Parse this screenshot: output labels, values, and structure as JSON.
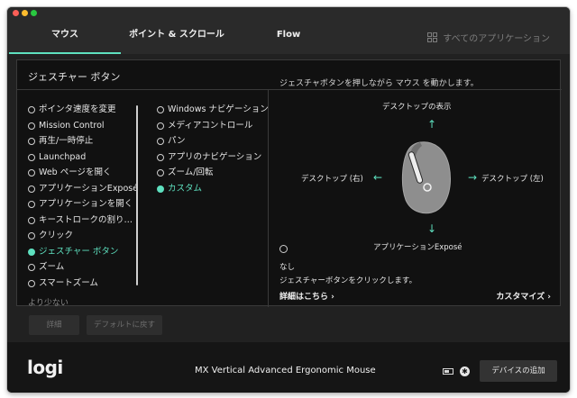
{
  "tabs": [
    {
      "label": "マウス"
    },
    {
      "label": "ポイント & スクロール"
    },
    {
      "label": "Flow"
    }
  ],
  "all_apps": {
    "label": "すべてのアプリケーション",
    "icon": "grid-icon"
  },
  "panel": {
    "title": "ジェスチャー ボタン",
    "hint": "ジェスチャボタンを押しながら マウス を動かします。",
    "list1": [
      {
        "label": "ポインタ速度を変更"
      },
      {
        "label": "Mission Control"
      },
      {
        "label": "再生/一時停止"
      },
      {
        "label": "Launchpad"
      },
      {
        "label": "Web ページを開く"
      },
      {
        "label": "アプリケーションExposé"
      },
      {
        "label": "アプリケーションを開く"
      },
      {
        "label": "キーストロークの割り…"
      },
      {
        "label": "クリック"
      },
      {
        "label": "ジェスチャー ボタン"
      },
      {
        "label": "ズーム"
      },
      {
        "label": "スマートズーム"
      }
    ],
    "list2": [
      {
        "label": "Windows ナビゲーション"
      },
      {
        "label": "メディアコントロール"
      },
      {
        "label": "パン"
      },
      {
        "label": "アプリのナビゲーション"
      },
      {
        "label": "ズーム/回転"
      },
      {
        "label": "カスタム"
      }
    ],
    "selected_list1": "ジェスチャー ボタン",
    "selected_list2": "カスタム",
    "less_label": "より少ない"
  },
  "diagram": {
    "up_label": "デスクトップの表示",
    "left_label": "デスクトップ (右)",
    "right_label": "デスクトップ (左)",
    "down_label": "アプリケーションExposé",
    "none_label": "なし",
    "none_desc": "ジェスチャーボタンをクリックします。",
    "learn_more": "詳細はこちら",
    "customize": "カスタマイズ"
  },
  "buttons": {
    "detail": "詳細",
    "reset": "デフォルトに戻す"
  },
  "footer": {
    "logo": "logi",
    "device": "MX Vertical Advanced Ergonomic Mouse",
    "add_device": "デバイスの追加"
  },
  "colors": {
    "accent": "#5ee0bf",
    "panel_bg": "#111111",
    "window_bg": "#212121"
  }
}
